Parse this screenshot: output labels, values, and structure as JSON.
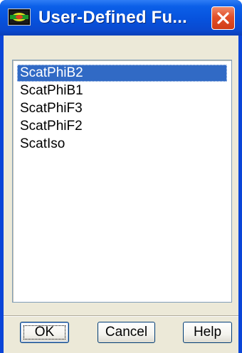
{
  "window": {
    "title": "User-Defined Fu...",
    "icon": "fluent-app-icon",
    "close_icon": "close-icon"
  },
  "list": {
    "items": [
      {
        "label": "ScatPhiB2",
        "selected": true
      },
      {
        "label": "ScatPhiB1",
        "selected": false
      },
      {
        "label": "ScatPhiF3",
        "selected": false
      },
      {
        "label": "ScatPhiF2",
        "selected": false
      },
      {
        "label": "ScatIso",
        "selected": false
      }
    ]
  },
  "buttons": {
    "ok_label": "OK",
    "cancel_label": "Cancel",
    "help_label": "Help"
  },
  "colors": {
    "titlebar": "#0752dd",
    "selection": "#316ac5",
    "close": "#e2502a",
    "dialog_bg": "#ece9d8"
  }
}
